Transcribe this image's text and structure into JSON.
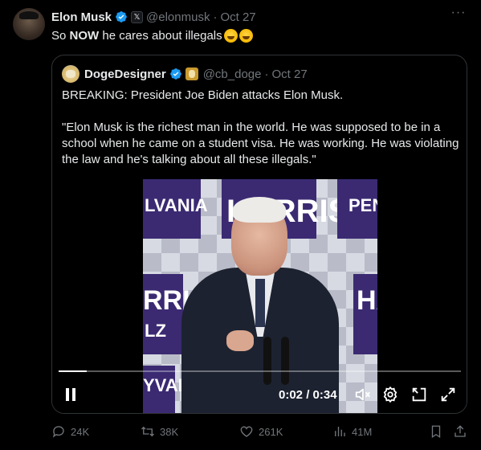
{
  "post": {
    "author_name": "Elon Musk",
    "author_handle": "@elonmusk",
    "separator": "·",
    "date": "Oct 27",
    "text": "So NOW he cares about illegals",
    "more_label": "···",
    "x_badge": "𝕏",
    "emojis": [
      "rolling-on-floor-laughing",
      "rolling-on-floor-laughing"
    ]
  },
  "quote": {
    "author_name": "DogeDesigner",
    "author_handle": "@cb_doge",
    "separator": "·",
    "date": "Oct 27",
    "paragraph1": "BREAKING: President Joe Biden attacks Elon Musk.",
    "paragraph2": "\"Elon Musk is the richest man in the world. He was supposed to be in a school when he came on a student visa. He was working. He was violating the law and he's talking about all these illegals.\""
  },
  "video": {
    "time_display": "0:02 / 0:34",
    "progress": 0.07,
    "banners": {
      "left_top": "LVANIA",
      "left_bottom": "RRIS",
      "left_small": "LZ",
      "center_top": "HARRIS",
      "right_top": "PEN",
      "right_mid": "HA",
      "left_base": "YVAN"
    }
  },
  "actions": {
    "replies": "24K",
    "reposts": "38K",
    "likes": "261K",
    "views": "41M"
  },
  "colors": {
    "background": "#000000",
    "text": "#e7e9ea",
    "muted": "#71767b",
    "verified": "#1d9bf0",
    "border": "#2f3336",
    "banner": "#3b2a72"
  }
}
